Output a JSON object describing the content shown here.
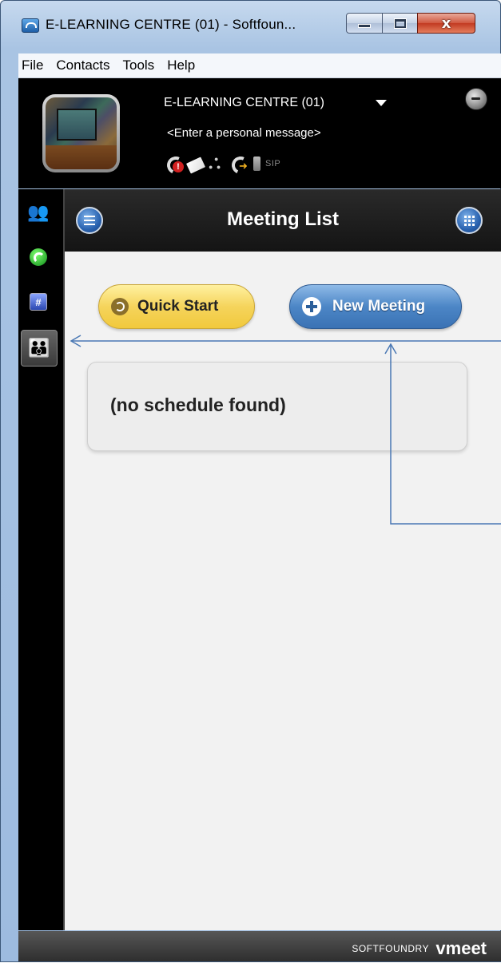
{
  "window": {
    "title": "E-LEARNING CENTRE (01) - Softfoun..."
  },
  "window_controls": {
    "minimize_icon": "minimize-icon",
    "maximize_icon": "maximize-icon",
    "close_label": "x"
  },
  "menu": {
    "items": [
      "File",
      "Contacts",
      "Tools",
      "Help"
    ]
  },
  "profile": {
    "name": "E-LEARNING CENTRE (01)",
    "personal_message": "<Enter a personal message>",
    "sip_label": "SIP"
  },
  "sidebar": {
    "items": [
      {
        "name": "contacts",
        "icon": "contacts-icon"
      },
      {
        "name": "phone",
        "icon": "phone-icon"
      },
      {
        "name": "dialpad",
        "icon": "dialpad-icon"
      },
      {
        "name": "meeting",
        "icon": "meeting-icon",
        "selected": true
      }
    ]
  },
  "meeting": {
    "title": "Meeting List",
    "quick_start_label": "Quick Start",
    "new_meeting_label": "New Meeting",
    "empty_message": "(no schedule found)"
  },
  "footer": {
    "brand_small": "SOFTFOUNDRY",
    "brand_large": "vmeet"
  },
  "colors": {
    "accent_blue": "#3a72b4",
    "quick_start_yellow": "#f5d45c",
    "annotation_arrow": "#4a78b4"
  }
}
